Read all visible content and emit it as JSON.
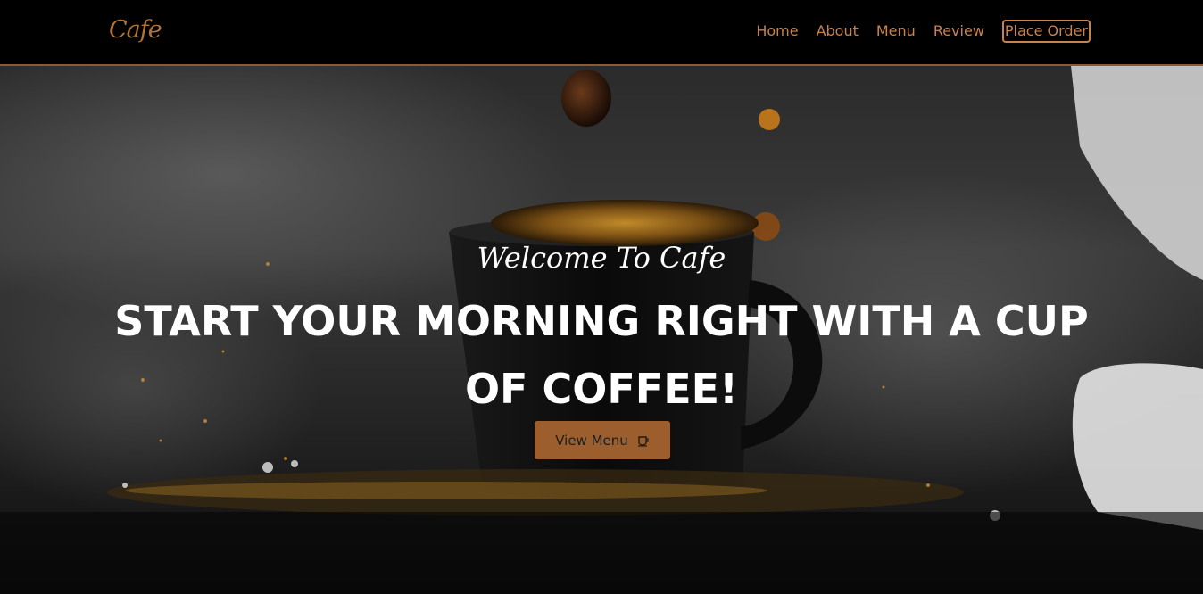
{
  "nav": {
    "brand": "Cafe",
    "links": [
      {
        "label": "Home"
      },
      {
        "label": "About"
      },
      {
        "label": "Menu"
      },
      {
        "label": "Review"
      }
    ],
    "cta_label": "Place Order"
  },
  "hero": {
    "welcome": "Welcome To Cafe",
    "headline": "START YOUR MORNING RIGHT WITH A CUP OF COFFEE!",
    "button_label": "View Menu",
    "button_icon": "coffee-cup-icon"
  },
  "colors": {
    "accent": "#b0733a",
    "button": "#9c5e2c",
    "nav_border": "#8a5a36"
  }
}
